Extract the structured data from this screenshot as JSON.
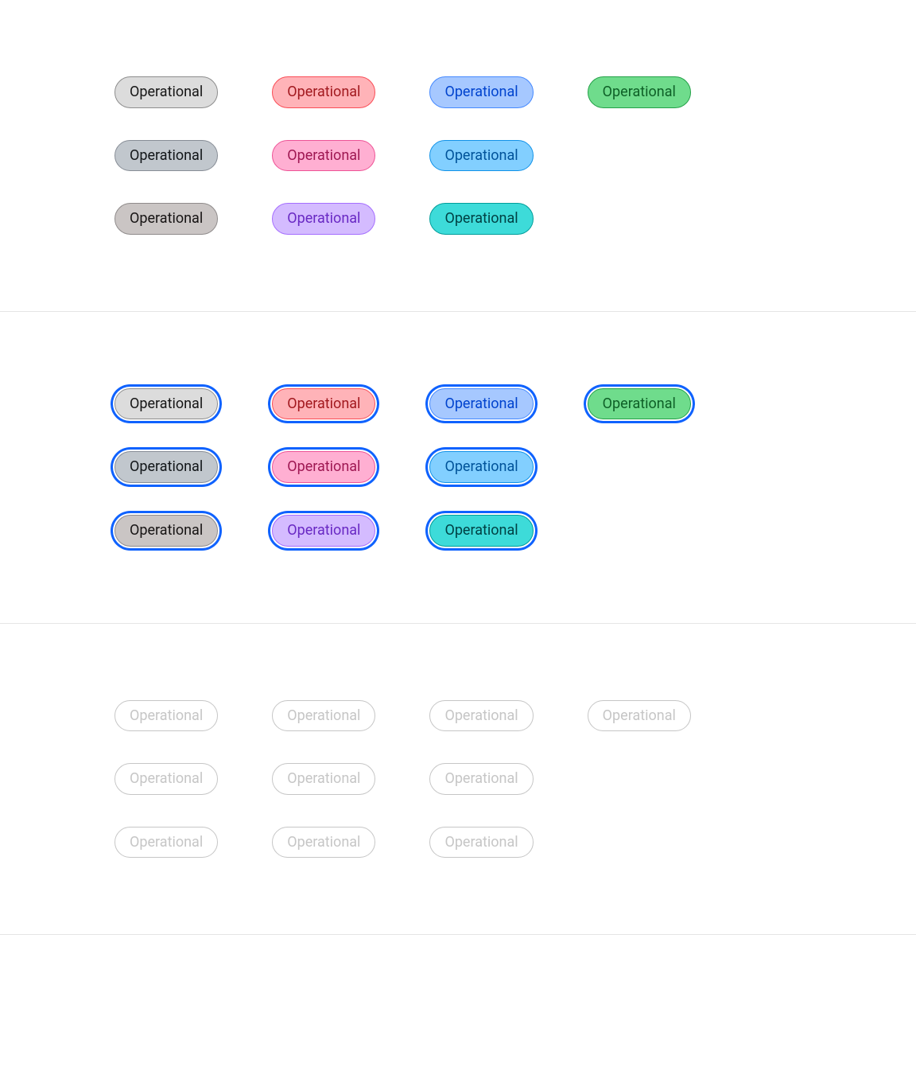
{
  "label": "Operational",
  "sections": [
    {
      "state": "default"
    },
    {
      "state": "selected"
    },
    {
      "state": "disabled"
    }
  ],
  "variants": [
    {
      "name": "gray",
      "row": 0
    },
    {
      "name": "red",
      "row": 0
    },
    {
      "name": "blue",
      "row": 0
    },
    {
      "name": "green",
      "row": 0
    },
    {
      "name": "cool-gray",
      "row": 1
    },
    {
      "name": "magenta",
      "row": 1
    },
    {
      "name": "cyan",
      "row": 1
    },
    {
      "name": "empty",
      "row": 1
    },
    {
      "name": "warm-gray",
      "row": 2
    },
    {
      "name": "purple",
      "row": 2
    },
    {
      "name": "teal",
      "row": 2
    },
    {
      "name": "empty",
      "row": 2
    }
  ],
  "colors": {
    "focus_ring": "#0f62fe",
    "divider": "#e5e5e5"
  }
}
